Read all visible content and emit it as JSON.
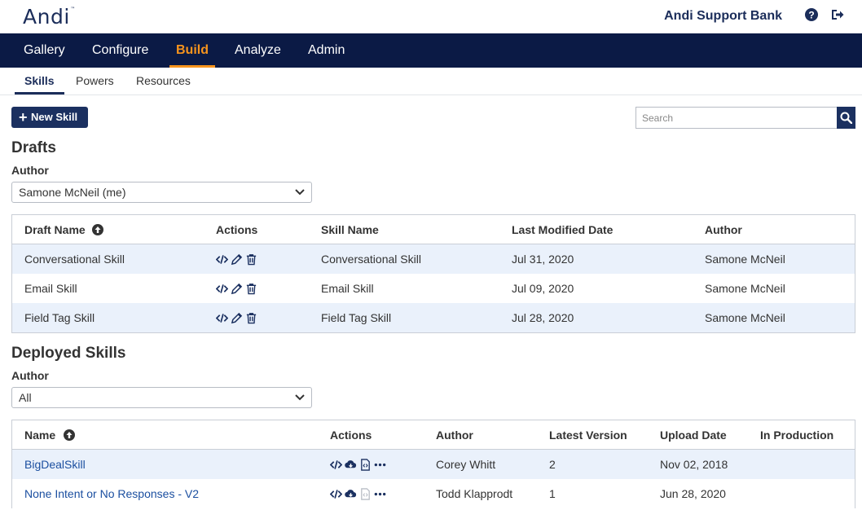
{
  "header": {
    "logo_text": "Andi",
    "logo_tm": "™",
    "org_name": "Andi Support Bank",
    "help_icon": "question-circle-icon",
    "logout_icon": "sign-out-icon"
  },
  "main_nav": [
    {
      "label": "Gallery",
      "active": false
    },
    {
      "label": "Configure",
      "active": false
    },
    {
      "label": "Build",
      "active": true
    },
    {
      "label": "Analyze",
      "active": false
    },
    {
      "label": "Admin",
      "active": false
    }
  ],
  "sub_nav": [
    {
      "label": "Skills",
      "active": true
    },
    {
      "label": "Powers",
      "active": false
    },
    {
      "label": "Resources",
      "active": false
    }
  ],
  "toolbar": {
    "new_button_label": "New Skill",
    "search_placeholder": "Search",
    "search_value": ""
  },
  "drafts": {
    "title": "Drafts",
    "author_label": "Author",
    "author_selected": "Samone McNeil (me)",
    "columns": [
      "Draft Name",
      "Actions",
      "Skill Name",
      "Last Modified Date",
      "Author"
    ],
    "rows": [
      {
        "draft_name": "Conversational Skill",
        "skill_name": "Conversational Skill",
        "modified": "Jul 31, 2020",
        "author": "Samone McNeil"
      },
      {
        "draft_name": "Email Skill",
        "skill_name": "Email Skill",
        "modified": "Jul 09, 2020",
        "author": "Samone McNeil"
      },
      {
        "draft_name": "Field Tag Skill",
        "skill_name": "Field Tag Skill",
        "modified": "Jul 28, 2020",
        "author": "Samone McNeil"
      }
    ]
  },
  "deployed": {
    "title": "Deployed Skills",
    "author_label": "Author",
    "author_selected": "All",
    "columns": [
      "Name",
      "Actions",
      "Author",
      "Latest Version",
      "Upload Date",
      "In Production"
    ],
    "rows": [
      {
        "name": "BigDealSkill",
        "author": "Corey Whitt",
        "version": "2",
        "upload_date": "Nov 02, 2018",
        "in_production": ""
      },
      {
        "name": "None Intent or No Responses - V2",
        "author": "Todd Klapprodt",
        "version": "1",
        "upload_date": "Jun 28, 2020",
        "in_production": ""
      }
    ]
  },
  "colors": {
    "nav_bg": "#0b1a45",
    "accent": "#f7941d",
    "brand": "#1b2d5a",
    "row_stripe": "#eaf1fb",
    "link": "#1b4fa0"
  }
}
